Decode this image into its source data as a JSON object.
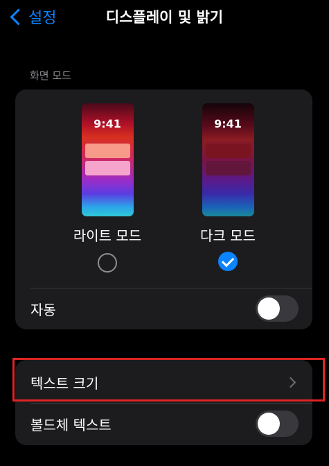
{
  "nav": {
    "back_label": "설정",
    "title": "디스플레이 및 밝기"
  },
  "section": {
    "label": "화면 모드"
  },
  "modes": [
    {
      "label": "라이트 모드",
      "time": "9:41",
      "selected": false
    },
    {
      "label": "다크 모드",
      "time": "9:41",
      "selected": true
    }
  ],
  "auto": {
    "label": "자동",
    "on": false
  },
  "text_size": {
    "label": "텍스트 크기"
  },
  "bold_text": {
    "label": "볼드체 텍스트",
    "on": false
  },
  "colors": {
    "accent": "#0a84ff",
    "highlight": "#e02424",
    "card": "#1c1c1e"
  },
  "icons": [
    "chevron-left-icon",
    "checkmark-icon",
    "chevron-right-icon"
  ]
}
